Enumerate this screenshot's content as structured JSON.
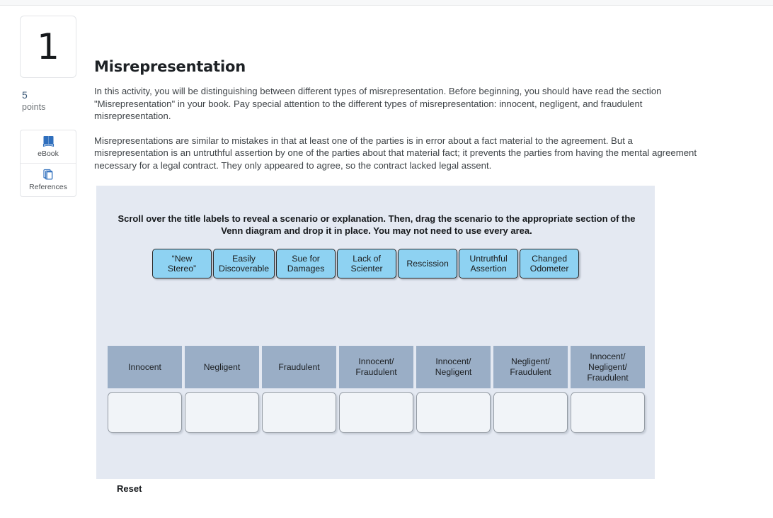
{
  "topbar": {
    "present": true
  },
  "sidebar": {
    "question_number": "1",
    "points_value": "5",
    "points_label": "points",
    "tools": [
      {
        "icon": "ebook-icon",
        "label": "eBook"
      },
      {
        "icon": "references-icon",
        "label": "References"
      }
    ]
  },
  "main": {
    "title": "Misrepresentation",
    "paragraphs": [
      "In this activity, you will be distinguishing between different types of misrepresentation. Before beginning, you should have read the section \"Misrepresentation\" in your book. Pay special attention to the different types of misrepresentation: innocent, negligent, and fraudulent misrepresentation.",
      "Misrepresentations are similar to mistakes in that at least one of the parties is in error about a fact material to the agreement. But a misrepresentation is an untruthful assertion by one of the parties about that material fact; it prevents the parties from having the mental agreement necessary for a legal contract. They only appeared to agree, so the contract lacked legal assent."
    ]
  },
  "activity": {
    "instructions": "Scroll over the title labels to reveal a scenario or explanation. Then, drag the scenario to the appropriate section of the Venn diagram and drop it in place. You may not need to use every area.",
    "tiles": [
      {
        "label": "“New\nStereo”"
      },
      {
        "label": "Easily\nDiscoverable"
      },
      {
        "label": "Sue for\nDamages"
      },
      {
        "label": "Lack of\nScienter"
      },
      {
        "label": "Rescission"
      },
      {
        "label": "Untruthful\nAssertion"
      },
      {
        "label": "Changed\nOdometer"
      }
    ],
    "columns": [
      {
        "header": "Innocent",
        "dropzone_value": ""
      },
      {
        "header": "Negligent",
        "dropzone_value": ""
      },
      {
        "header": "Fraudulent",
        "dropzone_value": ""
      },
      {
        "header": "Innocent/\nFraudulent",
        "dropzone_value": ""
      },
      {
        "header": "Innocent/\nNegligent",
        "dropzone_value": ""
      },
      {
        "header": "Negligent/\nFraudulent",
        "dropzone_value": ""
      },
      {
        "header": "Innocent/\nNegligent/\nFraudulent",
        "dropzone_value": ""
      }
    ],
    "reset_label": "Reset"
  },
  "colors": {
    "tile_blue": "#8ed2f2",
    "header_gray_blue": "#9aaec6",
    "panel_bg": "#e4e9f2",
    "dropzone_bg": "#f1f4f8",
    "accent_blue": "#3c5a78",
    "icon_blue": "#2f6fbd"
  }
}
